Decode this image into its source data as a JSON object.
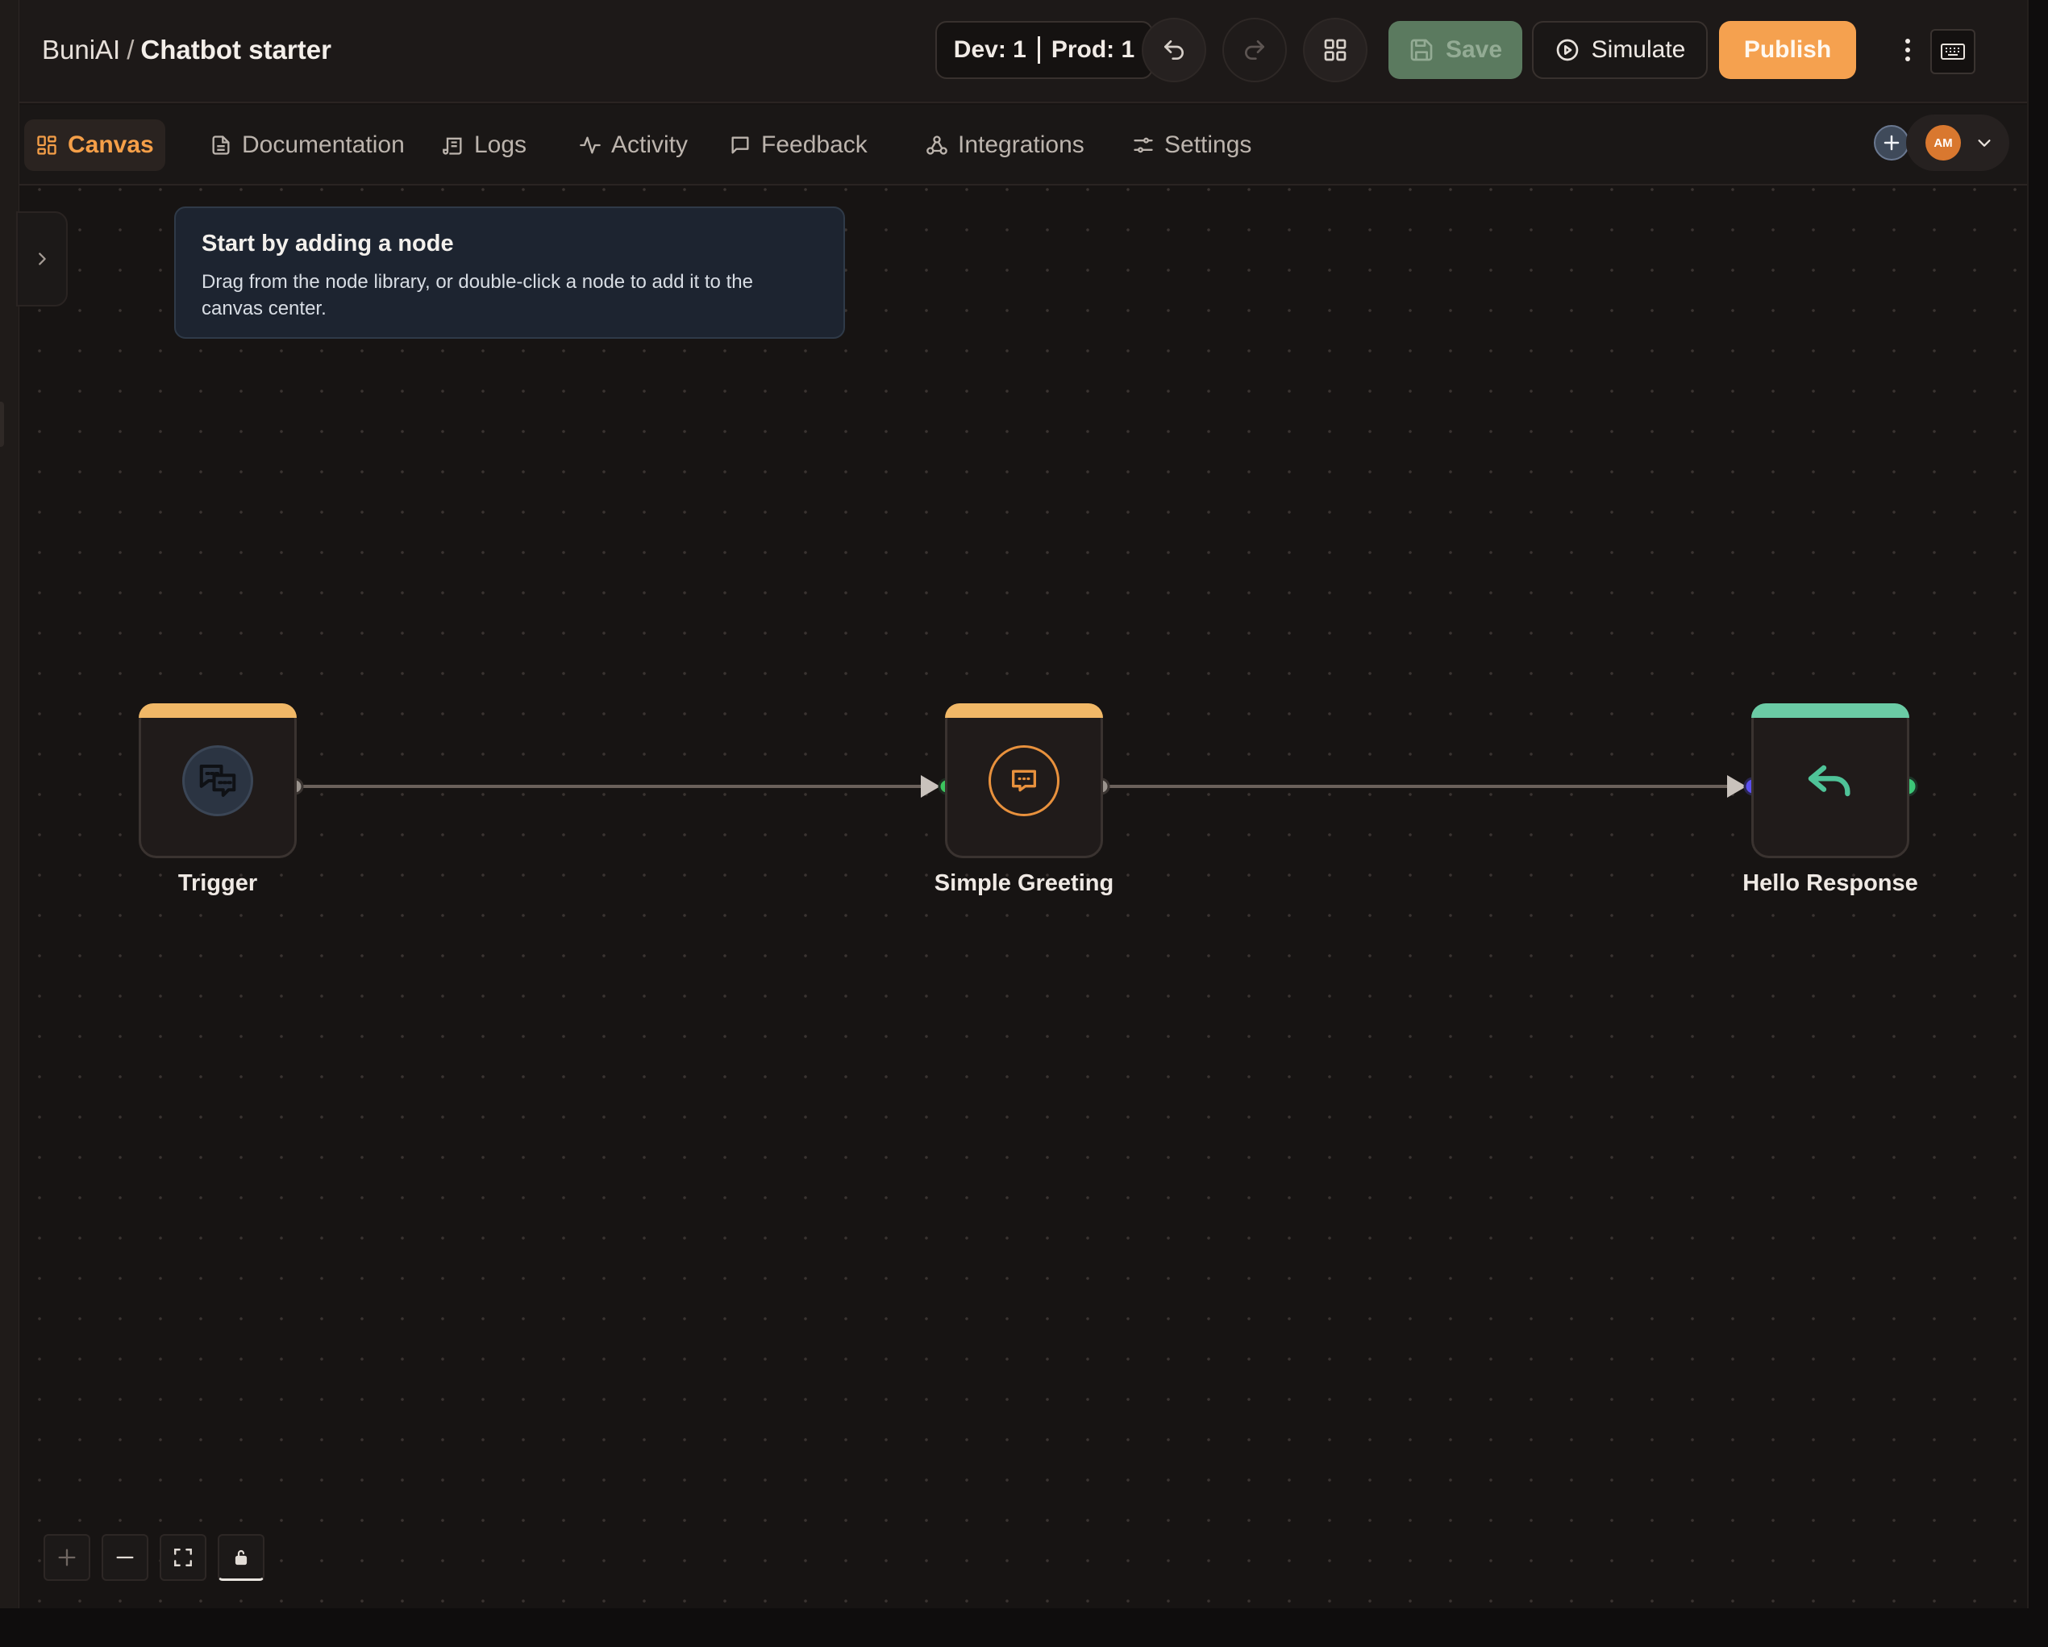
{
  "header": {
    "breadcrumb_org": "BuniAI",
    "breadcrumb_sep": "/",
    "project_name": "Chatbot starter",
    "version_dev": "Dev: 1",
    "version_prod": "Prod: 1",
    "save_label": "Save",
    "simulate_label": "Simulate",
    "publish_label": "Publish"
  },
  "tabs": [
    {
      "label": "Canvas",
      "icon": "grid-icon",
      "active": true
    },
    {
      "label": "Documentation",
      "icon": "document-icon"
    },
    {
      "label": "Logs",
      "icon": "scroll-icon"
    },
    {
      "label": "Activity",
      "icon": "activity-icon"
    },
    {
      "label": "Feedback",
      "icon": "message-icon"
    },
    {
      "label": "Integrations",
      "icon": "webhook-icon"
    },
    {
      "label": "Settings",
      "icon": "sliders-icon"
    }
  ],
  "user": {
    "initials": "AM"
  },
  "hint": {
    "title": "Start by adding a node",
    "body": "Drag from the node library, or double-click a node to add it to the canvas center."
  },
  "nodes": [
    {
      "label": "Trigger",
      "icon": "chat-bubbles-icon",
      "accent": "#f1b867"
    },
    {
      "label": "Simple Greeting",
      "icon": "message-dots-icon",
      "accent": "#f1b867"
    },
    {
      "label": "Hello Response",
      "icon": "reply-icon",
      "accent": "#6bcba5"
    }
  ],
  "edges": [
    {
      "from": "Trigger",
      "to": "Simple Greeting"
    },
    {
      "from": "Simple Greeting",
      "to": "Hello Response"
    }
  ],
  "colors": {
    "accent": "#f5a14f",
    "save_bg": "#5b7a5f",
    "hint_bg": "#1d2430"
  }
}
